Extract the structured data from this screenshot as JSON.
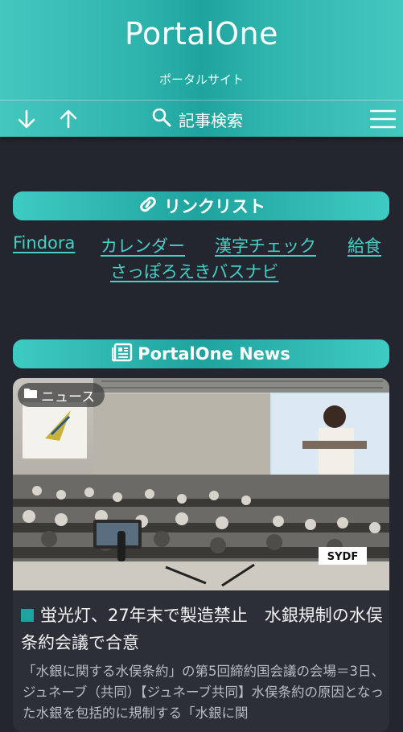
{
  "header": {
    "title": "PortalOne",
    "subtitle": "ポータルサイト",
    "search_label": "記事検索",
    "icons": [
      "arrow-down-icon",
      "arrow-up-icon",
      "search-icon",
      "hamburger-menu-icon"
    ]
  },
  "links": {
    "heading": "リンクリスト",
    "items": [
      "Findora",
      "カレンダー",
      "漢字チェック",
      "給食",
      "さっぽろえきバスナビ"
    ]
  },
  "news": {
    "heading": "PortalOne News",
    "category": "ニュース",
    "article_title": "蛍光灯、27年末で製造禁止　水銀規制の水俣条約会議で合意",
    "article_excerpt": "「水銀に関する水俣条約」の第5回締約国会議の会場＝3日、ジュネーブ（共同）【ジュネーブ共同】水俣条約の原因となった水銀を包括的に規制する「水銀に関",
    "photo_sign": "SYDF"
  },
  "colors": {
    "accent": "#1fa39e",
    "link": "#46d0c6",
    "background": "#23262f"
  }
}
